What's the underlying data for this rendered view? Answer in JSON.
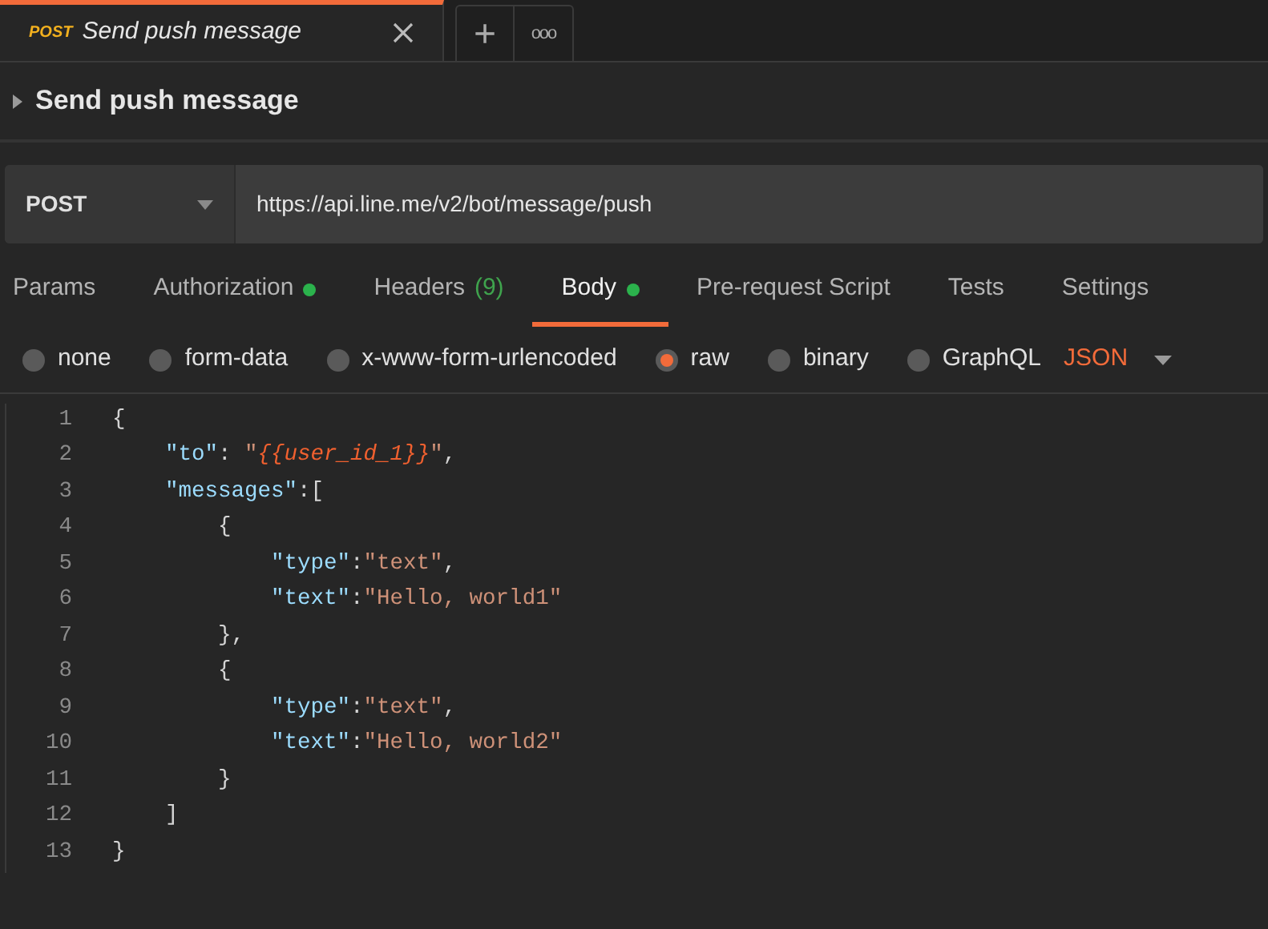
{
  "request_tabs": [
    {
      "method": "POST",
      "title": "Send push message",
      "selected": true
    }
  ],
  "tab_actions": {
    "new_tab": "+",
    "more": "ooo"
  },
  "request_name": "Send push message",
  "method": "POST",
  "url": "https://api.line.me/v2/bot/message/push",
  "tabs": [
    {
      "label": "Params",
      "selected": false,
      "dot": false
    },
    {
      "label": "Authorization",
      "selected": false,
      "dot": true
    },
    {
      "label": "Headers",
      "count": "(9)",
      "selected": false,
      "dot": false
    },
    {
      "label": "Body",
      "selected": true,
      "dot": true
    },
    {
      "label": "Pre-request Script",
      "selected": false,
      "dot": false
    },
    {
      "label": "Tests",
      "selected": false,
      "dot": false
    },
    {
      "label": "Settings",
      "selected": false,
      "dot": false
    }
  ],
  "body_types": [
    {
      "label": "none",
      "selected": false
    },
    {
      "label": "form-data",
      "selected": false
    },
    {
      "label": "x-www-form-urlencoded",
      "selected": false
    },
    {
      "label": "raw",
      "selected": true
    },
    {
      "label": "binary",
      "selected": false
    },
    {
      "label": "GraphQL",
      "selected": false
    }
  ],
  "format": "JSON",
  "code_lines": [
    {
      "number": "1",
      "tokens": [
        {
          "kind": "punct",
          "text": "{"
        }
      ]
    },
    {
      "number": "2",
      "tokens": [
        {
          "kind": "key",
          "text": "    \"to\""
        },
        {
          "kind": "punct",
          "text": ": "
        },
        {
          "kind": "string",
          "text": "\""
        },
        {
          "kind": "variable",
          "text": "{{user_id_1}}"
        },
        {
          "kind": "string",
          "text": "\""
        },
        {
          "kind": "punct",
          "text": ","
        }
      ]
    },
    {
      "number": "3",
      "tokens": [
        {
          "kind": "key",
          "text": "    \"messages\""
        },
        {
          "kind": "punct",
          "text": ":["
        }
      ]
    },
    {
      "number": "4",
      "tokens": [
        {
          "kind": "punct",
          "text": "        {"
        }
      ]
    },
    {
      "number": "5",
      "tokens": [
        {
          "kind": "key",
          "text": "            \"type\""
        },
        {
          "kind": "punct",
          "text": ":"
        },
        {
          "kind": "string",
          "text": "\"text\""
        },
        {
          "kind": "punct",
          "text": ","
        }
      ]
    },
    {
      "number": "6",
      "tokens": [
        {
          "kind": "key",
          "text": "            \"text\""
        },
        {
          "kind": "punct",
          "text": ":"
        },
        {
          "kind": "string",
          "text": "\"Hello, world1\""
        }
      ]
    },
    {
      "number": "7",
      "tokens": [
        {
          "kind": "punct",
          "text": "        },"
        }
      ]
    },
    {
      "number": "8",
      "tokens": [
        {
          "kind": "punct",
          "text": "        {"
        }
      ]
    },
    {
      "number": "9",
      "tokens": [
        {
          "kind": "key",
          "text": "            \"type\""
        },
        {
          "kind": "punct",
          "text": ":"
        },
        {
          "kind": "string",
          "text": "\"text\""
        },
        {
          "kind": "punct",
          "text": ","
        }
      ]
    },
    {
      "number": "10",
      "tokens": [
        {
          "kind": "key",
          "text": "            \"text\""
        },
        {
          "kind": "punct",
          "text": ":"
        },
        {
          "kind": "string",
          "text": "\"Hello, world2\""
        }
      ]
    },
    {
      "number": "11",
      "tokens": [
        {
          "kind": "punct",
          "text": "        }"
        }
      ]
    },
    {
      "number": "12",
      "tokens": [
        {
          "kind": "punct",
          "text": "    ]"
        }
      ]
    },
    {
      "number": "13",
      "tokens": [
        {
          "kind": "punct",
          "text": "}"
        }
      ]
    }
  ]
}
